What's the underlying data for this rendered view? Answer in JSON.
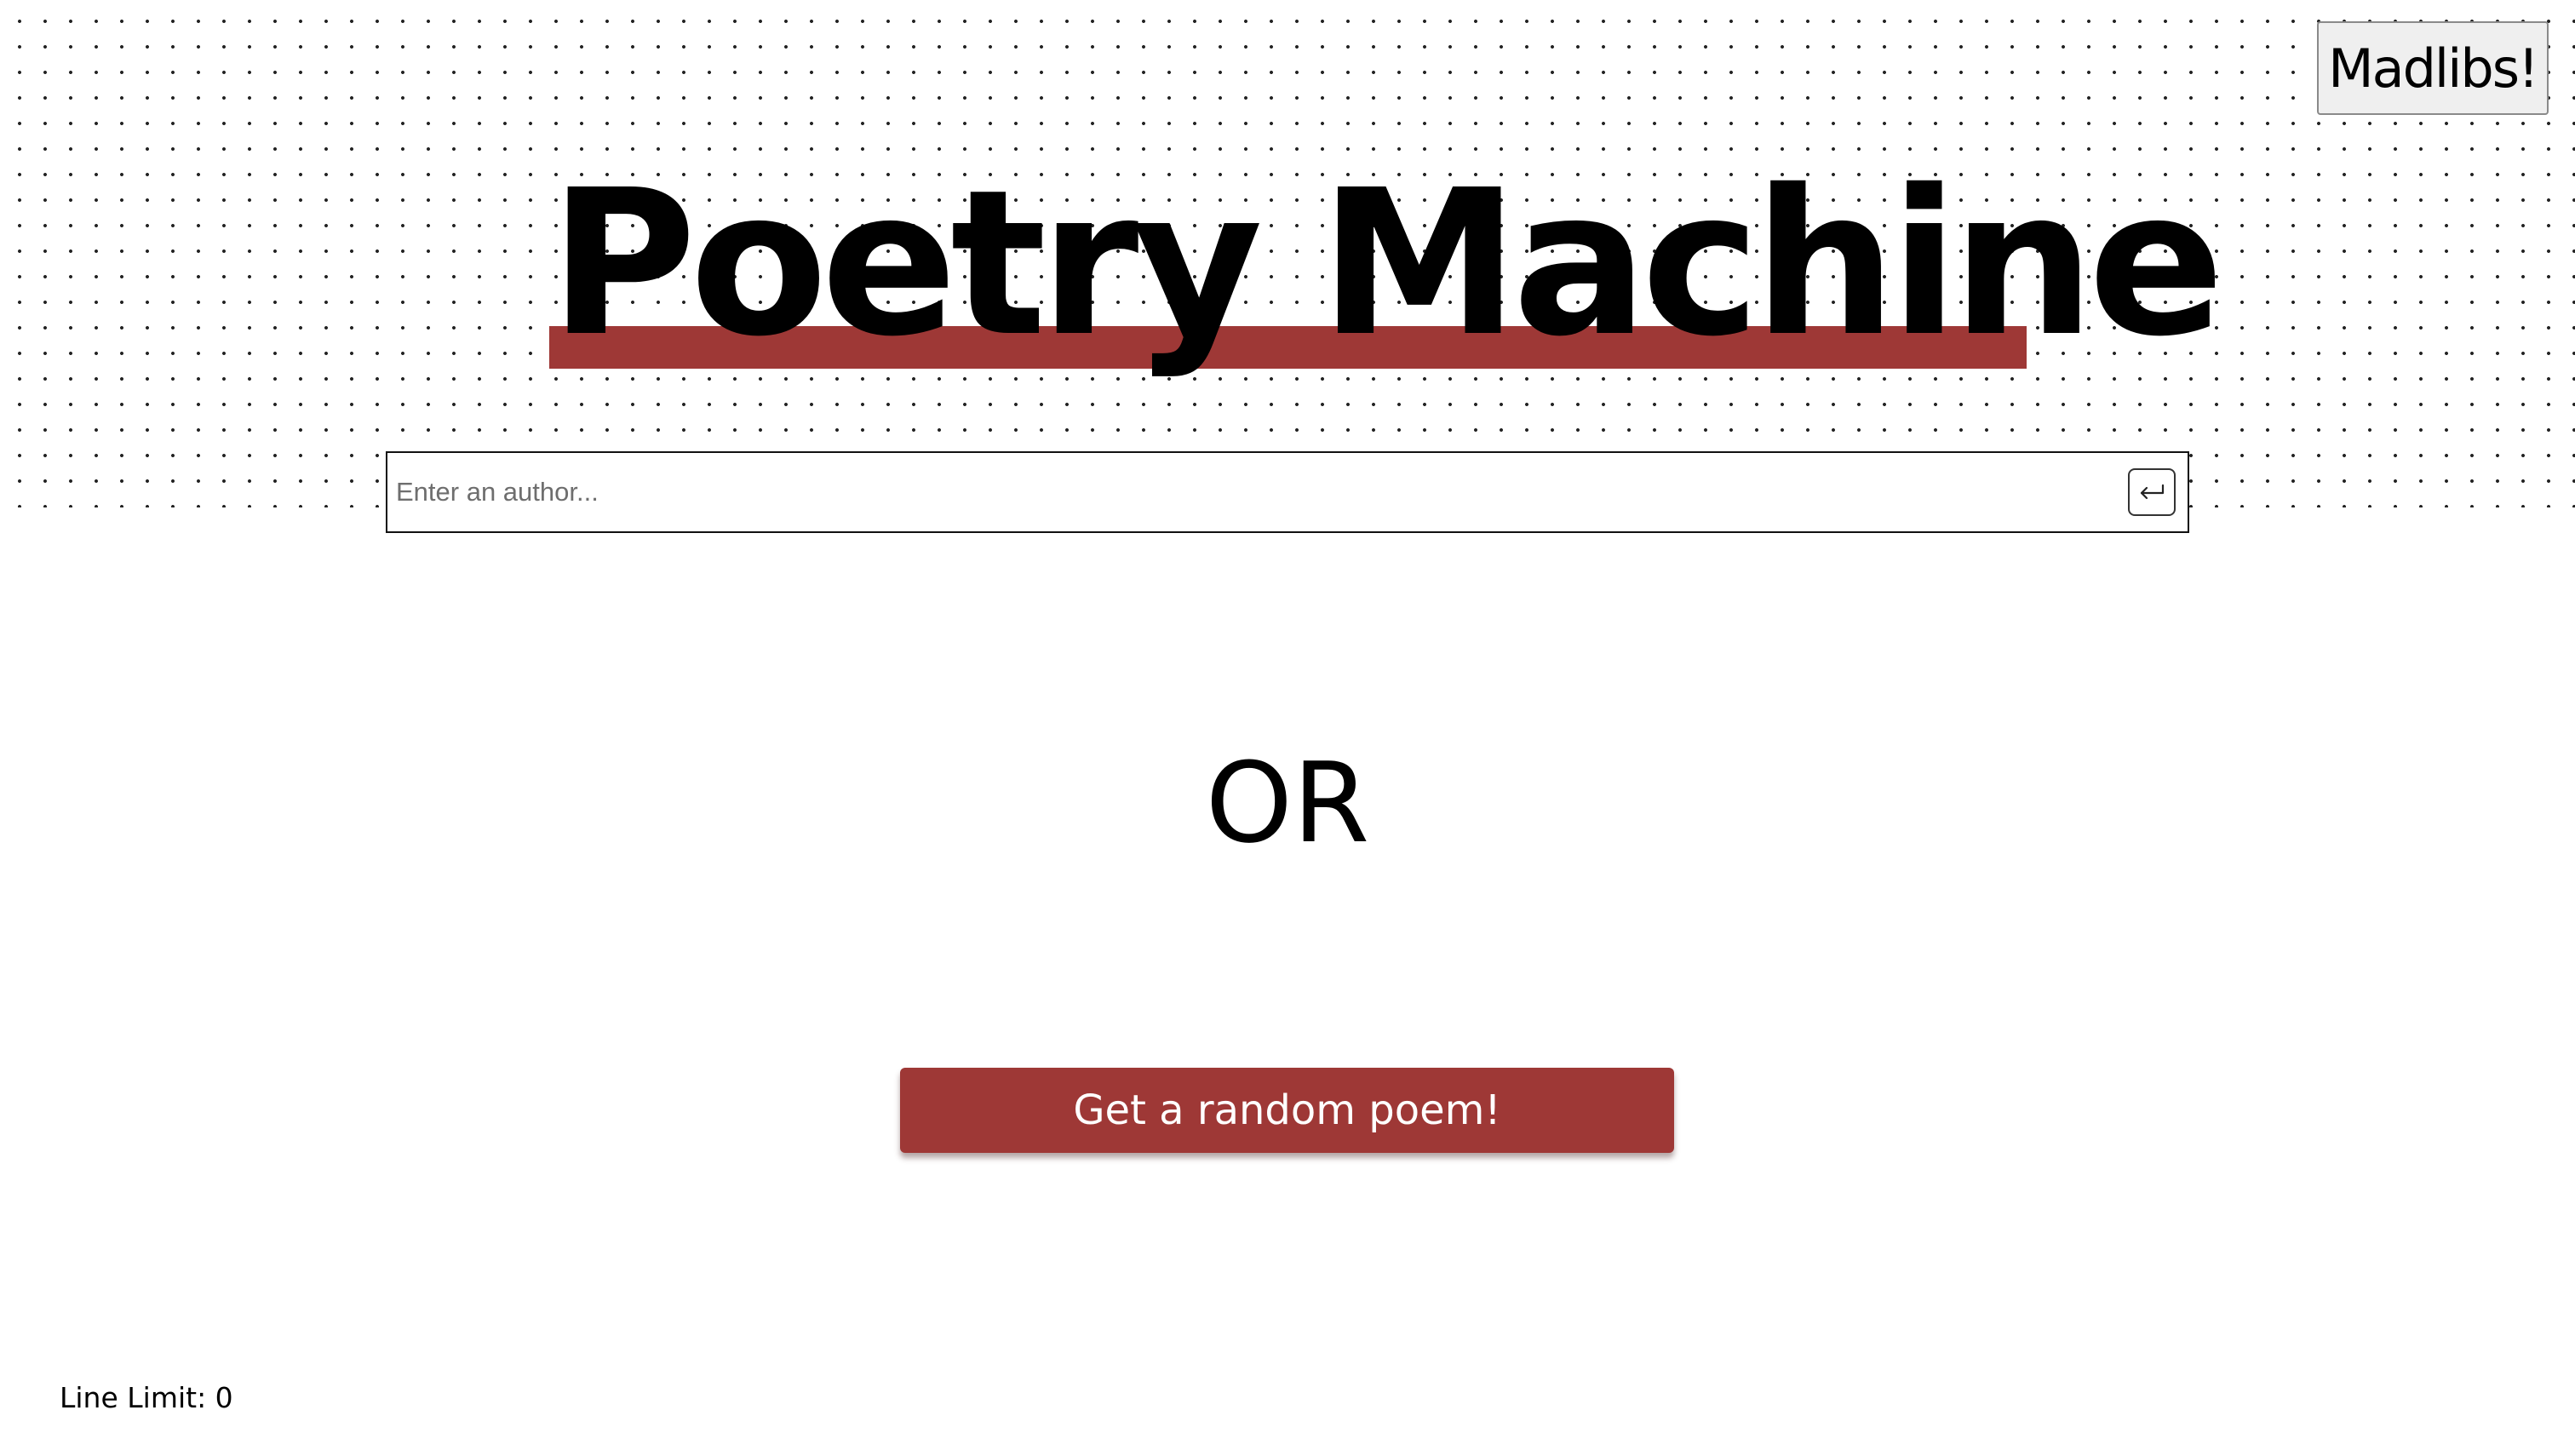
{
  "header": {
    "madlibs_label": "Madlibs!",
    "title": "Poetry Machine"
  },
  "search": {
    "placeholder": "Enter an author...",
    "value": "",
    "submit_icon": "return-arrow-icon"
  },
  "separator": {
    "text": "OR"
  },
  "random": {
    "label": "Get a random poem!"
  },
  "footer": {
    "line_limit": "Line Limit: 0"
  },
  "colors": {
    "accent": "#9e3836",
    "background": "#ffffff",
    "text": "#000000",
    "dots": "#222222"
  }
}
